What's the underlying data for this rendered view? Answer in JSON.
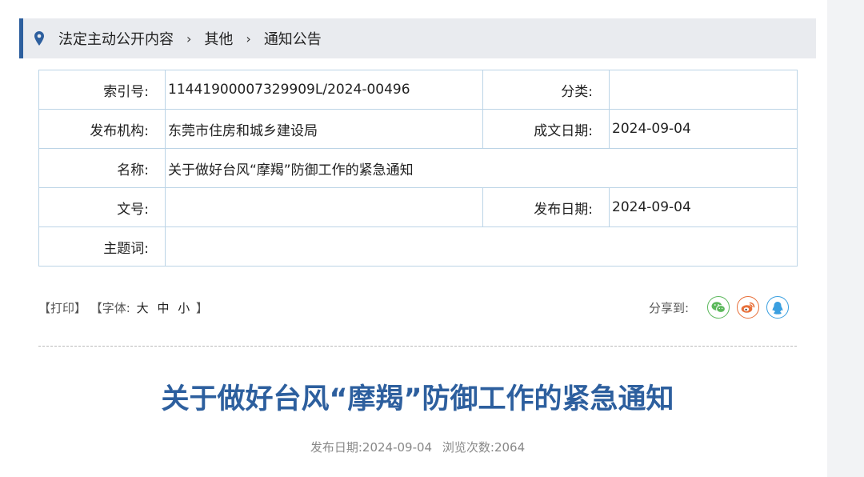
{
  "breadcrumb": {
    "items": [
      "法定主动公开内容",
      "其他",
      "通知公告"
    ],
    "separator": "›"
  },
  "meta": {
    "index_label": "索引号:",
    "index_value": "11441900007329909L/2024-00496",
    "category_label": "分类:",
    "category_value": "",
    "publisher_label": "发布机构:",
    "publisher_value": "东莞市住房和城乡建设局",
    "written_date_label": "成文日期:",
    "written_date_value": "2024-09-04",
    "name_label": "名称:",
    "name_value": "关于做好台风“摩羯”防御工作的紧急通知",
    "doc_no_label": "文号:",
    "doc_no_value": "",
    "publish_date_label": "发布日期:",
    "publish_date_value": "2024-09-04",
    "keywords_label": "主题词:",
    "keywords_value": ""
  },
  "tools": {
    "print_label": "【打印】",
    "font_prefix": "【字体:",
    "font_large": "大",
    "font_medium": "中",
    "font_small": "小",
    "font_suffix": "】",
    "share_label": "分享到:",
    "share_icons": [
      "wechat-icon",
      "weibo-icon",
      "qq-icon"
    ]
  },
  "article": {
    "title": "关于做好台风“摩羯”防御工作的紧急通知",
    "publish_date_label": "发布日期:",
    "publish_date": "2024-09-04",
    "views_label": "浏览次数:",
    "views": "2064"
  },
  "colors": {
    "accent": "#2d5f9e",
    "breadcrumb_bg": "#e9ebef",
    "table_border": "#bcd4e6"
  }
}
